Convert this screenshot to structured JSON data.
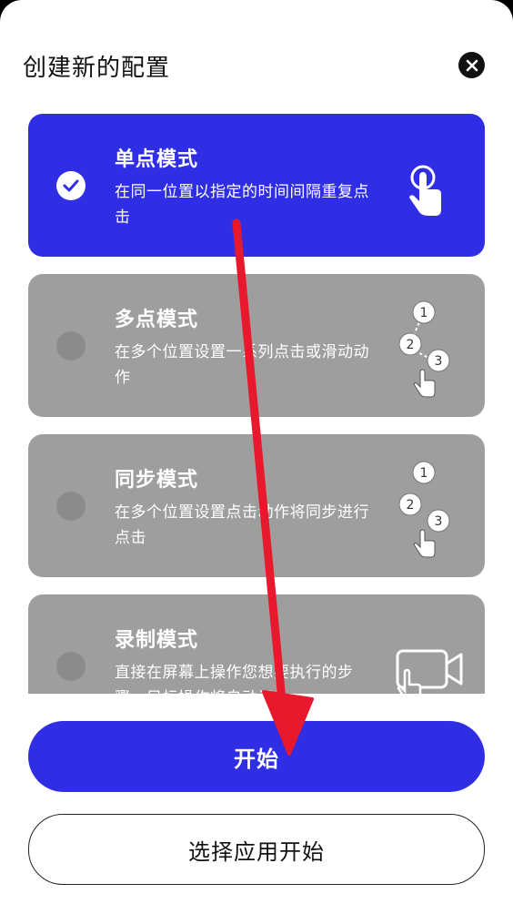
{
  "dialog": {
    "title": "创建新的配置",
    "close_icon": "close-icon"
  },
  "modes": [
    {
      "title": "单点模式",
      "desc": "在同一位置以指定的时间间隔重复点击",
      "selected": true,
      "icon": "single-tap-icon"
    },
    {
      "title": "多点模式",
      "desc": "在多个位置设置一系列点击或滑动动作",
      "selected": false,
      "icon": "multi-tap-icon",
      "icon_labels": [
        "1",
        "2",
        "3"
      ]
    },
    {
      "title": "同步模式",
      "desc": "在多个位置设置点击动作将同步进行点击",
      "selected": false,
      "icon": "sync-tap-icon",
      "icon_labels": [
        "1",
        "2",
        "3"
      ]
    },
    {
      "title": "录制模式",
      "desc": "直接在屏幕上操作您想要执行的步骤，目标操作将自动记",
      "selected": false,
      "icon": "record-screen-icon"
    }
  ],
  "buttons": {
    "start": "开始",
    "select_app_start": "选择应用开始"
  },
  "colors": {
    "accent": "#2f2ee4",
    "card_inactive": "#9e9e9e",
    "annotation_arrow": "#e8192c"
  }
}
